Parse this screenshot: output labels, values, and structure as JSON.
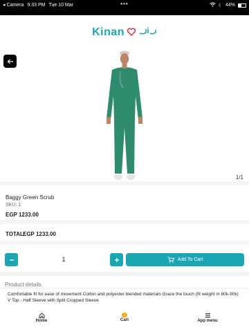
{
  "status_bar": {
    "app": "Camera",
    "time": "9:33 PM",
    "date": "Tue 10 Mar",
    "dots": "•••",
    "battery": "44%"
  },
  "logo": {
    "text": "Kinan"
  },
  "product": {
    "name": "Baggy Green Scrub",
    "sku": "SKU: 1",
    "price": "EGP 1233.00",
    "image_counter": "1/1"
  },
  "total": {
    "label": "TOTAL:",
    "value": "EGP 1233.00"
  },
  "quantity": {
    "value": "1"
  },
  "cart_button": {
    "label": "Add To Cart"
  },
  "details": {
    "heading": "Product details",
    "line1": "Comfortable fit for ease of movement Cotton and polyester blended materials Grace the touch (fit weight m 80k-90k)",
    "line2": "V Top - Half Sleeve with Split Cropped Sleeve"
  },
  "nav": {
    "home": "Home",
    "cart": "Cart",
    "menu": "App menu"
  },
  "colors": {
    "accent": "#1aa7b3",
    "scrub": "#2e8b6e",
    "badge": "#f0b429"
  }
}
